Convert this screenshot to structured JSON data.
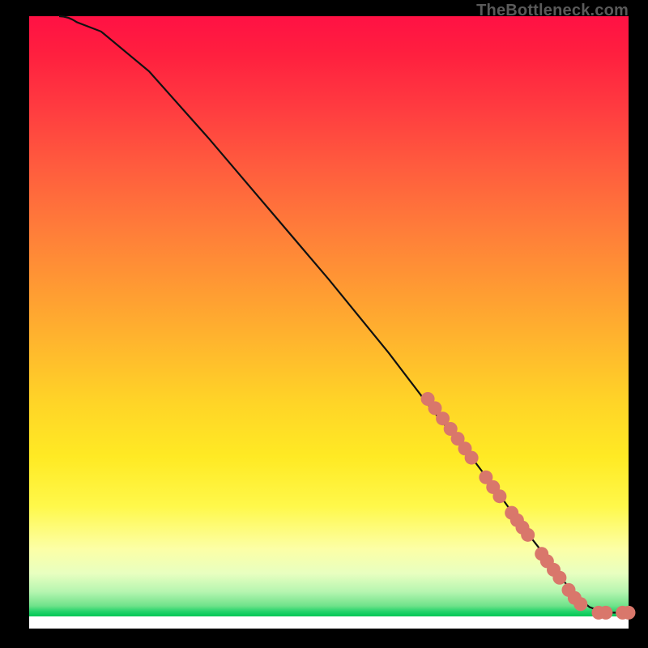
{
  "watermark": "TheBottleneck.com",
  "colors": {
    "dot": "#d9776b",
    "curve": "#111111",
    "background": "#000000"
  },
  "chart_data": {
    "type": "line",
    "title": "",
    "xlabel": "",
    "ylabel": "",
    "xlim": [
      0,
      100
    ],
    "ylim": [
      0,
      100
    ],
    "grid": false,
    "legend": false,
    "curve": {
      "x": [
        5,
        8,
        12,
        20,
        30,
        40,
        50,
        60,
        67,
        73,
        78,
        82,
        86,
        89,
        91,
        93.5,
        96,
        100
      ],
      "y": [
        100,
        99,
        97.5,
        91,
        80,
        68.5,
        57,
        45,
        36,
        29,
        22.5,
        17,
        12,
        8,
        5.5,
        3.5,
        2.6,
        2.6
      ]
    },
    "points": [
      {
        "x": 66.5,
        "y": 37.5
      },
      {
        "x": 67.7,
        "y": 36.0
      },
      {
        "x": 69.0,
        "y": 34.3
      },
      {
        "x": 70.3,
        "y": 32.6
      },
      {
        "x": 71.5,
        "y": 31.0
      },
      {
        "x": 72.7,
        "y": 29.4
      },
      {
        "x": 73.8,
        "y": 27.9
      },
      {
        "x": 76.2,
        "y": 24.7
      },
      {
        "x": 77.4,
        "y": 23.1
      },
      {
        "x": 78.5,
        "y": 21.6
      },
      {
        "x": 80.5,
        "y": 18.9
      },
      {
        "x": 81.4,
        "y": 17.7
      },
      {
        "x": 82.3,
        "y": 16.5
      },
      {
        "x": 83.2,
        "y": 15.3
      },
      {
        "x": 85.5,
        "y": 12.2
      },
      {
        "x": 86.4,
        "y": 11.0
      },
      {
        "x": 87.5,
        "y": 9.6
      },
      {
        "x": 88.5,
        "y": 8.3
      },
      {
        "x": 90.0,
        "y": 6.3
      },
      {
        "x": 91.0,
        "y": 5.0
      },
      {
        "x": 92.0,
        "y": 4.0
      },
      {
        "x": 95.0,
        "y": 2.6
      },
      {
        "x": 96.2,
        "y": 2.6
      },
      {
        "x": 99.0,
        "y": 2.6
      },
      {
        "x": 100.0,
        "y": 2.6
      }
    ]
  }
}
